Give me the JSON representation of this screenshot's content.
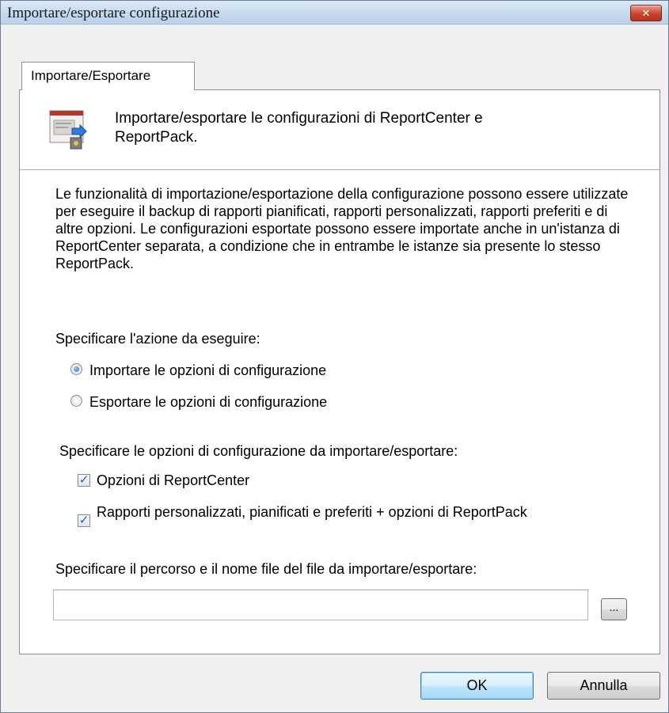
{
  "window": {
    "title": "Importare/esportare configurazione",
    "close_label": "✕"
  },
  "tab": {
    "label": "Importare/Esportare"
  },
  "header": {
    "icon": "import-export-config-icon",
    "text": "Importare/esportare le configurazioni di ReportCenter e ReportPack."
  },
  "description": "Le funzionalità di importazione/esportazione della configurazione possono essere utilizzate per eseguire il backup di rapporti pianificati, rapporti personalizzati, rapporti preferiti e di altre opzioni. Le configurazioni esportate possono essere importate anche in un'istanza di ReportCenter separata, a condizione che in entrambe le istanze sia presente lo stesso ReportPack.",
  "action": {
    "label": "Specificare l'azione da eseguire:",
    "options": [
      {
        "label": "Importare le opzioni di configurazione",
        "selected": true
      },
      {
        "label": "Esportare le opzioni di configurazione",
        "selected": false
      }
    ]
  },
  "config_options": {
    "label": "Specificare le opzioni di configurazione da importare/esportare:",
    "items": [
      {
        "label": "Opzioni di ReportCenter",
        "checked": true
      },
      {
        "label": "Rapporti personalizzati, pianificati e preferiti + opzioni di ReportPack",
        "checked": true
      }
    ]
  },
  "file": {
    "label": "Specificare il percorso e il nome file del file da importare/esportare:",
    "value": "",
    "browse_label": "..."
  },
  "buttons": {
    "ok": "OK",
    "cancel": "Annulla"
  }
}
